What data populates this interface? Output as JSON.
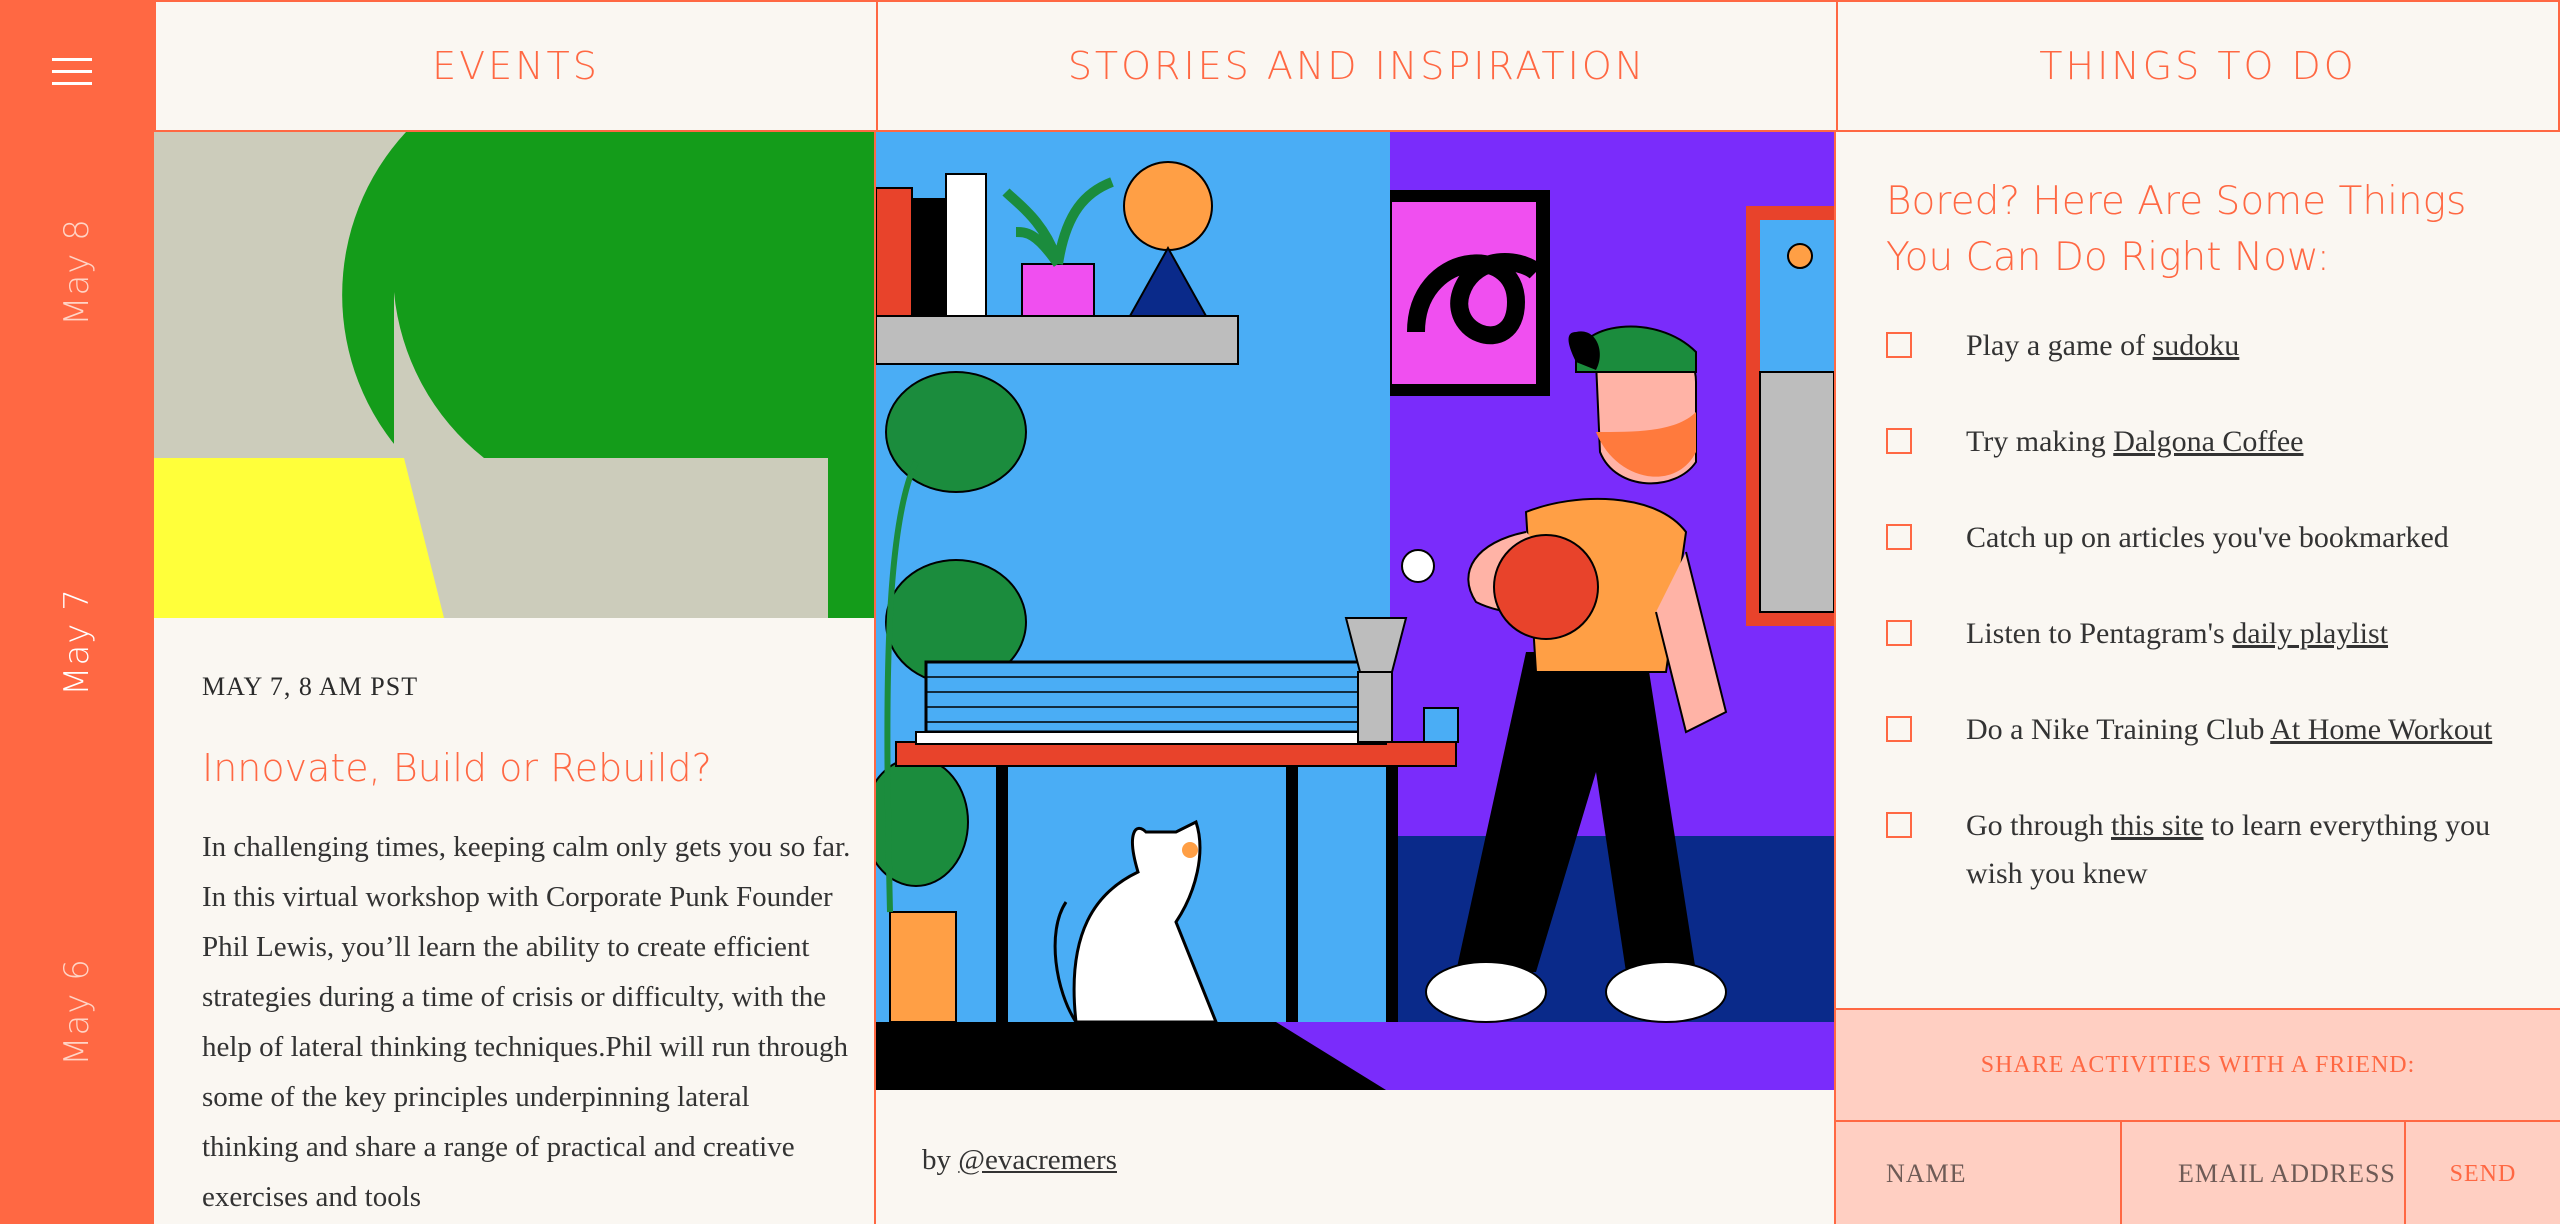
{
  "sidebar": {
    "menu_icon": "hamburger-menu-icon",
    "dates": [
      "May 8",
      "May 7",
      "May 6"
    ],
    "active_date": "May 7"
  },
  "columns": {
    "events": "EVENTS",
    "stories": "STORIES AND INSPIRATION",
    "things": "THINGS TO DO"
  },
  "event": {
    "meta": "MAY 7, 8 AM PST",
    "title": "Innovate, Build or Rebuild?",
    "body": "In challenging times, keeping calm only gets you so far. In this virtual workshop with Corporate Punk Founder Phil Lewis, you’ll learn the ability to create efficient strategies during a time of crisis or difficulty, with the help of lateral thinking techniques.Phil will run through some of the key principles underpinning lateral thinking and share a range of practical and creative exercises and tools"
  },
  "story": {
    "credit_prefix": "by ",
    "credit_handle": "@evacremers"
  },
  "things": {
    "title": "Bored? Here Are Some Things You Can Do Right Now:",
    "items": [
      {
        "before": "Play a game of ",
        "link": "sudoku",
        "after": ""
      },
      {
        "before": "Try making ",
        "link": "Dalgona Coffee",
        "after": ""
      },
      {
        "before": "Catch up on articles you've bookmarked",
        "link": "",
        "after": ""
      },
      {
        "before": "Listen to Pentagram's ",
        "link": "daily playlist",
        "after": ""
      },
      {
        "before": "Do a Nike Training Club ",
        "link": "At Home Workout",
        "after": ""
      },
      {
        "before": "Go through ",
        "link": "this site",
        "after": " to learn everything you wish you knew"
      }
    ]
  },
  "share": {
    "heading": "SHARE ACTIVITIES WITH A FRIEND:",
    "name_placeholder": "NAME",
    "email_placeholder": "EMAIL ADDRESS",
    "send_label": "SEND"
  },
  "colors": {
    "accent": "#ff6843",
    "background": "#faf7f2",
    "share_bg": "#ffcfc2"
  }
}
